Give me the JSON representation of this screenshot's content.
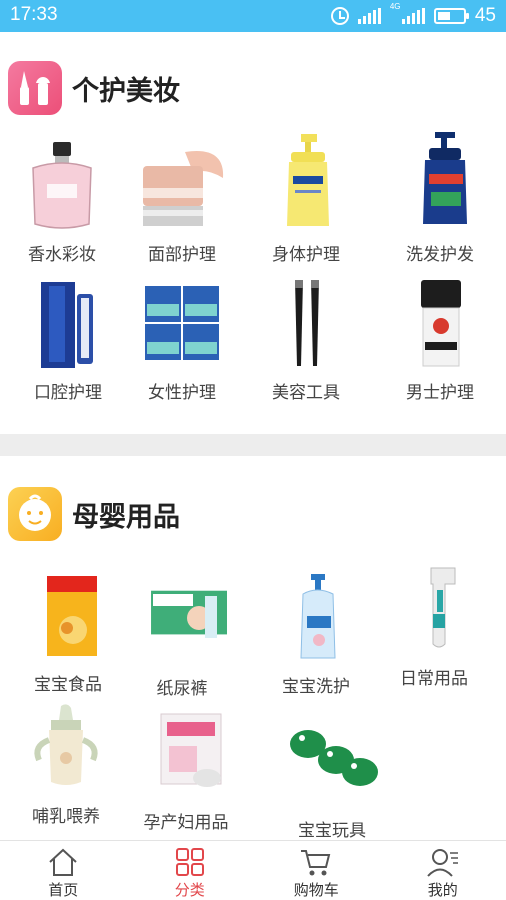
{
  "status_bar": {
    "time": "17:33",
    "network_tag": "4G",
    "battery": "45"
  },
  "sections": [
    {
      "title": "个护美妆",
      "icon": "makeup-icon",
      "icon_color": "#f0578a",
      "items": [
        {
          "label": "香水彩妆",
          "icon": "perfume-bottle-icon"
        },
        {
          "label": "面部护理",
          "icon": "face-cream-jar-icon"
        },
        {
          "label": "身体护理",
          "icon": "body-lotion-bottle-icon"
        },
        {
          "label": "洗发护发",
          "icon": "shampoo-bottle-icon"
        },
        {
          "label": "口腔护理",
          "icon": "toothpaste-icon"
        },
        {
          "label": "女性护理",
          "icon": "sanitary-pads-icon"
        },
        {
          "label": "美容工具",
          "icon": "tweezers-icon"
        },
        {
          "label": "男士护理",
          "icon": "men-cream-icon"
        }
      ]
    },
    {
      "title": "母婴用品",
      "icon": "baby-face-icon",
      "icon_color": "#fbbe34",
      "items": [
        {
          "label": "宝宝食品",
          "icon": "baby-food-box-icon"
        },
        {
          "label": "纸尿裤",
          "icon": "diaper-pack-icon"
        },
        {
          "label": "宝宝洗护",
          "icon": "baby-wash-bottle-icon"
        },
        {
          "label": "日常用品",
          "icon": "thermometer-icon"
        },
        {
          "label": "哺乳喂养",
          "icon": "sippy-cup-icon"
        },
        {
          "label": "孕产妇用品",
          "icon": "maternity-pack-icon"
        },
        {
          "label": "宝宝玩具",
          "icon": "toy-frogs-icon"
        }
      ]
    }
  ],
  "bottom_nav": [
    {
      "label": "首页",
      "icon": "home-icon",
      "active": false
    },
    {
      "label": "分类",
      "icon": "grid-icon",
      "active": true
    },
    {
      "label": "购物车",
      "icon": "cart-icon",
      "active": false
    },
    {
      "label": "我的",
      "icon": "user-icon",
      "active": false
    }
  ],
  "colors": {
    "status_bar": "#49c0f3",
    "active_nav": "#e2474b",
    "divider": "#ededed"
  }
}
